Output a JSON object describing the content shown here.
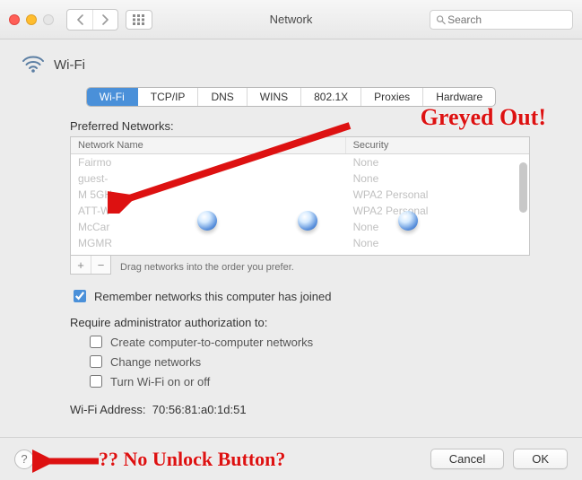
{
  "window": {
    "title": "Network"
  },
  "toolbar": {
    "search_placeholder": "Search"
  },
  "header": {
    "title": "Wi-Fi"
  },
  "tabs": [
    "Wi-Fi",
    "TCP/IP",
    "DNS",
    "WINS",
    "802.1X",
    "Proxies",
    "Hardware"
  ],
  "active_tab_index": 0,
  "preferred": {
    "label": "Preferred Networks:",
    "columns": {
      "name": "Network Name",
      "security": "Security"
    },
    "rows": [
      {
        "name": "Fairmo",
        "security": "None"
      },
      {
        "name": "guest-",
        "security": "None"
      },
      {
        "name": "M 5GH",
        "security": "WPA2 Personal"
      },
      {
        "name": "ATT-W",
        "security": "WPA2 Personal"
      },
      {
        "name": "McCar",
        "security": "None"
      },
      {
        "name": "MGMR",
        "security": "None"
      }
    ],
    "hint": "Drag networks into the order you prefer.",
    "add_label": "+",
    "remove_label": "−"
  },
  "remember": {
    "label": "Remember networks this computer has joined",
    "checked": true
  },
  "admin": {
    "label": "Require administrator authorization to:",
    "items": [
      {
        "label": "Create computer-to-computer networks",
        "checked": false
      },
      {
        "label": "Change networks",
        "checked": false
      },
      {
        "label": "Turn Wi-Fi on or off",
        "checked": false
      }
    ]
  },
  "address": {
    "label": "Wi-Fi Address:",
    "value": "70:56:81:a0:1d:51"
  },
  "footer": {
    "help": "?",
    "cancel": "Cancel",
    "ok": "OK"
  },
  "annotations": {
    "greyed_out": "Greyed Out!",
    "no_unlock": "?? No Unlock Button?"
  }
}
